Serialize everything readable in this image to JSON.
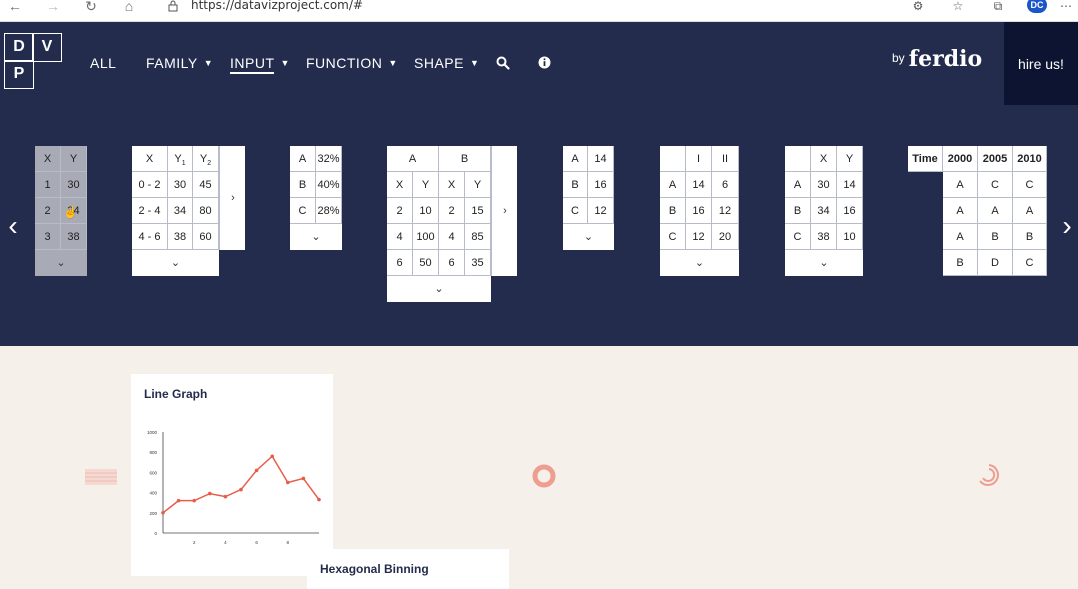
{
  "browser": {
    "url": "https://datavizproject.com/#",
    "back_icon": "back-arrow-icon",
    "forward_icon": "forward-arrow-icon",
    "refresh_icon": "refresh-icon",
    "home_icon": "home-icon",
    "profile_initials": "DC"
  },
  "header": {
    "logo_letters": [
      "D",
      "V",
      "P",
      ""
    ],
    "nav": [
      {
        "label": "ALL",
        "dropdown": false
      },
      {
        "label": "FAMILY",
        "dropdown": true
      },
      {
        "label": "INPUT",
        "dropdown": true
      },
      {
        "label": "FUNCTION",
        "dropdown": true
      },
      {
        "label": "SHAPE",
        "dropdown": true
      }
    ],
    "by_text": "by",
    "brand": "ferdio",
    "hire_label": "hire us!",
    "colors": {
      "header_bg": "#232c4c",
      "hire_bg": "#0c1432",
      "accent": "#e85c4a"
    }
  },
  "tables": {
    "t1": {
      "header": [
        "X",
        "Y"
      ],
      "rows": [
        [
          "1",
          "30"
        ],
        [
          "2",
          "34"
        ],
        [
          "3",
          "38"
        ]
      ]
    },
    "t2": {
      "header": [
        "X",
        "Y1",
        "Y2"
      ],
      "rows": [
        [
          "0 - 2",
          "30",
          "45"
        ],
        [
          "2 - 4",
          "34",
          "80"
        ],
        [
          "4 - 6",
          "38",
          "60"
        ]
      ]
    },
    "t3": {
      "rows": [
        [
          "A",
          "32%"
        ],
        [
          "B",
          "40%"
        ],
        [
          "C",
          "28%"
        ]
      ]
    },
    "t4": {
      "groups": [
        "A",
        "B"
      ],
      "header": [
        "X",
        "Y",
        "X",
        "Y"
      ],
      "rows": [
        [
          "2",
          "10",
          "2",
          "15"
        ],
        [
          "4",
          "100",
          "4",
          "85"
        ],
        [
          "6",
          "50",
          "6",
          "35"
        ]
      ]
    },
    "t5": {
      "rows": [
        [
          "A",
          "14"
        ],
        [
          "B",
          "16"
        ],
        [
          "C",
          "12"
        ]
      ]
    },
    "t6": {
      "header": [
        "",
        "I",
        "II"
      ],
      "rows": [
        [
          "A",
          "14",
          "6"
        ],
        [
          "B",
          "16",
          "12"
        ],
        [
          "C",
          "12",
          "20"
        ]
      ]
    },
    "t7": {
      "header": [
        "",
        "X",
        "Y"
      ],
      "rows": [
        [
          "A",
          "30",
          "14"
        ],
        [
          "B",
          "34",
          "16"
        ],
        [
          "C",
          "38",
          "10"
        ]
      ]
    },
    "t8": {
      "header": [
        "Time",
        "2000",
        "2005",
        "2010"
      ],
      "rows": [
        [
          "A",
          "C",
          "C"
        ],
        [
          "A",
          "A",
          "A"
        ],
        [
          "A",
          "B",
          "B"
        ],
        [
          "B",
          "D",
          "C"
        ]
      ]
    }
  },
  "gallery": {
    "cards": [
      {
        "title": "Line Graph"
      },
      {
        "title": "Hexagonal Binning"
      }
    ]
  },
  "chart_data": {
    "type": "line",
    "title": "",
    "x": [
      0,
      1,
      2,
      3,
      4,
      5,
      6,
      7,
      8,
      9,
      10
    ],
    "series": [
      {
        "values": [
          200,
          320,
          320,
          390,
          360,
          430,
          620,
          760,
          500,
          540,
          330
        ]
      }
    ],
    "xticks": [
      "2",
      "4",
      "6",
      "8"
    ],
    "yticks": [
      "0",
      "200",
      "400",
      "600",
      "800",
      "1000"
    ],
    "xlim": [
      0,
      10
    ],
    "ylim": [
      0,
      1000
    ],
    "color": "#e85c4a",
    "grid": false
  }
}
